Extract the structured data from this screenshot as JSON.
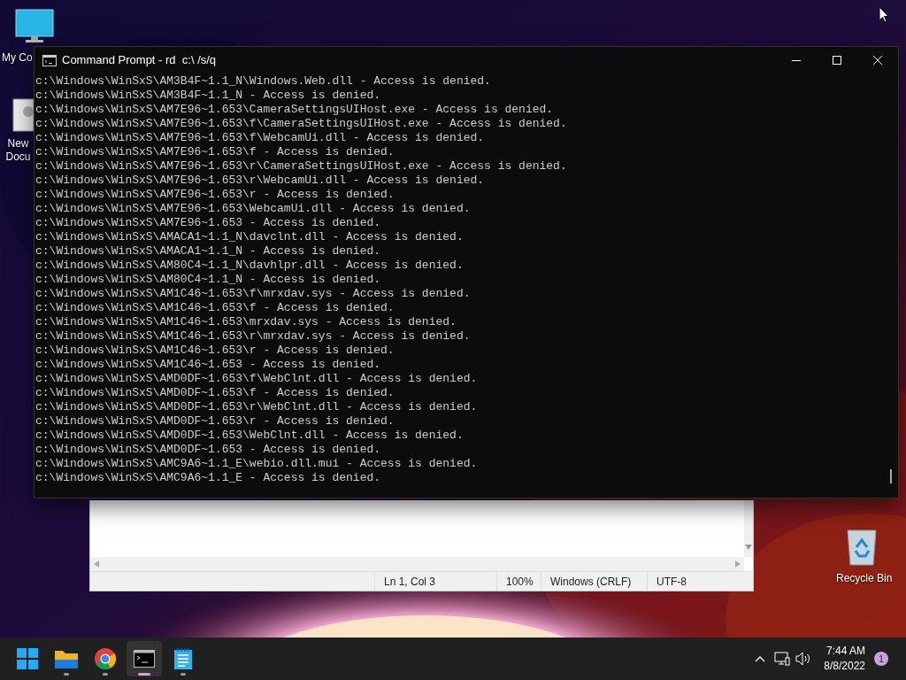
{
  "desktop_icons": [
    {
      "kind": "monitor",
      "label": "My Co"
    },
    {
      "kind": "document",
      "label": "New Docu"
    },
    {
      "kind": "recycle",
      "label": "Recycle Bin"
    }
  ],
  "console": {
    "title": "Command Prompt - rd  c:\\ /s/q",
    "lines": [
      "c:\\Windows\\WinSxS\\AM3B4F~1.1_N\\Windows.Web.dll - Access is denied.",
      "c:\\Windows\\WinSxS\\AM3B4F~1.1_N - Access is denied.",
      "c:\\Windows\\WinSxS\\AM7E96~1.653\\CameraSettingsUIHost.exe - Access is denied.",
      "c:\\Windows\\WinSxS\\AM7E96~1.653\\f\\CameraSettingsUIHost.exe - Access is denied.",
      "c:\\Windows\\WinSxS\\AM7E96~1.653\\f\\WebcamUi.dll - Access is denied.",
      "c:\\Windows\\WinSxS\\AM7E96~1.653\\f - Access is denied.",
      "c:\\Windows\\WinSxS\\AM7E96~1.653\\r\\CameraSettingsUIHost.exe - Access is denied.",
      "c:\\Windows\\WinSxS\\AM7E96~1.653\\r\\WebcamUi.dll - Access is denied.",
      "c:\\Windows\\WinSxS\\AM7E96~1.653\\r - Access is denied.",
      "c:\\Windows\\WinSxS\\AM7E96~1.653\\WebcamUi.dll - Access is denied.",
      "c:\\Windows\\WinSxS\\AM7E96~1.653 - Access is denied.",
      "c:\\Windows\\WinSxS\\AMACA1~1.1_N\\davclnt.dll - Access is denied.",
      "c:\\Windows\\WinSxS\\AMACA1~1.1_N - Access is denied.",
      "c:\\Windows\\WinSxS\\AM80C4~1.1_N\\davhlpr.dll - Access is denied.",
      "c:\\Windows\\WinSxS\\AM80C4~1.1_N - Access is denied.",
      "c:\\Windows\\WinSxS\\AM1C46~1.653\\f\\mrxdav.sys - Access is denied.",
      "c:\\Windows\\WinSxS\\AM1C46~1.653\\f - Access is denied.",
      "c:\\Windows\\WinSxS\\AM1C46~1.653\\mrxdav.sys - Access is denied.",
      "c:\\Windows\\WinSxS\\AM1C46~1.653\\r\\mrxdav.sys - Access is denied.",
      "c:\\Windows\\WinSxS\\AM1C46~1.653\\r - Access is denied.",
      "c:\\Windows\\WinSxS\\AM1C46~1.653 - Access is denied.",
      "c:\\Windows\\WinSxS\\AMD0DF~1.653\\f\\WebClnt.dll - Access is denied.",
      "c:\\Windows\\WinSxS\\AMD0DF~1.653\\f - Access is denied.",
      "c:\\Windows\\WinSxS\\AMD0DF~1.653\\r\\WebClnt.dll - Access is denied.",
      "c:\\Windows\\WinSxS\\AMD0DF~1.653\\r - Access is denied.",
      "c:\\Windows\\WinSxS\\AMD0DF~1.653\\WebClnt.dll - Access is denied.",
      "c:\\Windows\\WinSxS\\AMD0DF~1.653 - Access is denied.",
      "c:\\Windows\\WinSxS\\AMC9A6~1.1_E\\webio.dll.mui - Access is denied.",
      "c:\\Windows\\WinSxS\\AMC9A6~1.1_E - Access is denied."
    ]
  },
  "notepad": {
    "status_bar": [
      "Ln 1, Col 3",
      "100%",
      "Windows (CRLF)",
      "UTF-8"
    ]
  },
  "taskbar": {
    "apps": [
      {
        "kind": "start",
        "running": false,
        "selected": false
      },
      {
        "kind": "folder",
        "running": true,
        "selected": false
      },
      {
        "kind": "browser",
        "running": true,
        "selected": false
      },
      {
        "kind": "terminal",
        "running": true,
        "selected": true
      },
      {
        "kind": "notepad",
        "running": true,
        "selected": false
      }
    ],
    "time": "7:44 AM",
    "date": "8/8/2022",
    "notification_count": "1"
  }
}
